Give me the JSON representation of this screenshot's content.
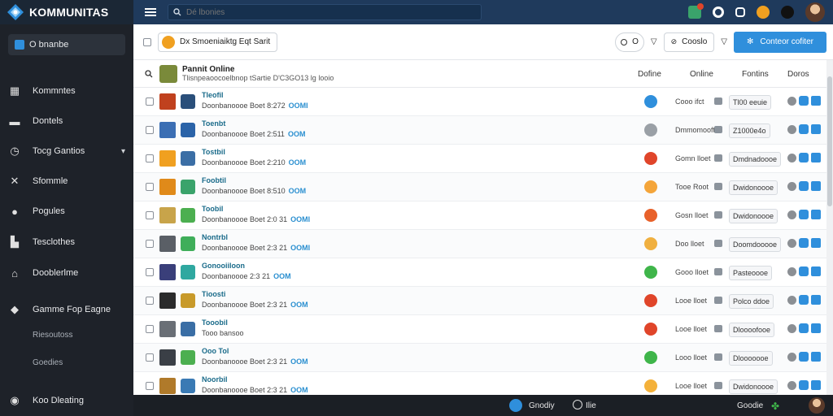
{
  "app": {
    "name": "KOMMUNITAS"
  },
  "search": {
    "placeholder": "Dé lbonies"
  },
  "sidebar": {
    "select_label": "O bnanbe",
    "items": [
      {
        "label": "Kommntes",
        "icon": "calendar-icon"
      },
      {
        "label": "Dontels",
        "icon": "chat-icon"
      },
      {
        "label": "Tocg Gantios",
        "icon": "clock-icon"
      },
      {
        "label": "Sfommle",
        "icon": "cross-icon"
      },
      {
        "label": "Pogules",
        "icon": "comment-icon"
      },
      {
        "label": "Tesclothes",
        "icon": "building-icon"
      },
      {
        "label": "Dooblerlme",
        "icon": "home-icon"
      },
      {
        "label": "Gamme Fop Eagne",
        "icon": "diamond-icon"
      },
      {
        "label": "Koo Dleating",
        "icon": "globe-icon"
      }
    ],
    "sub_items": [
      "Riesoutoss",
      "Goedies"
    ]
  },
  "toolbar": {
    "filter_label": "Dx Smoeniaiktg Eqt Sarit",
    "view_label": "O",
    "sort_label": "Cooslo",
    "primary_label": "Conteor cofiter"
  },
  "list": {
    "title": "Pannit Online",
    "subtitle": "Tlisnpeaoocoelbnop tSartie D'C3GO13 lg looio",
    "columns": [
      "Dofine",
      "Online",
      "Fontins",
      "Doros"
    ]
  },
  "rows": [
    {
      "title": "Tleofil",
      "meta": "Doonbanoooe Boet 8:272",
      "tag": "OOMI",
      "status": "#2f8fdc",
      "online": "Cooo ifct",
      "forum": "Tl00 eeuie",
      "thumb": "#c0411e",
      "thumb2": "#2a4f7a"
    },
    {
      "title": "Toenbt",
      "meta": "Doonbanoooe Boet 2:511",
      "tag": "OOM",
      "status": "#9aa0a6",
      "online": "Dmmomooft",
      "forum": "Z1000e4o",
      "thumb": "#3c6fb4",
      "thumb2": "#2a63a8"
    },
    {
      "title": "Tostbil",
      "meta": "Doonbanoooe Boet 2:210",
      "tag": "OOM",
      "status": "#e0452a",
      "online": "Gomn lloet",
      "forum": "Dmdnadoooe",
      "thumb": "#f0a020",
      "thumb2": "#3b6ea5"
    },
    {
      "title": "Foobtil",
      "meta": "Doonbanoooe Boet 8:510",
      "tag": "OOM",
      "status": "#f4a53a",
      "online": "Tooe Root",
      "forum": "Dwidonoooe",
      "thumb": "#e08a1a",
      "thumb2": "#3aa36b"
    },
    {
      "title": "Toobil",
      "meta": "Doonbanoooe Boet 2:0 31",
      "tag": "OOMI",
      "status": "#e8612a",
      "online": "Gosn lloet",
      "forum": "Dwidonoooe",
      "thumb": "#c8a44a",
      "thumb2": "#4caf50"
    },
    {
      "title": "Nontrbl",
      "meta": "Doonbanoooe Boet 2:3 21",
      "tag": "OOMI",
      "status": "#f0b040",
      "online": "Doo lloet",
      "forum": "Doomdooooe",
      "thumb": "#5a5f66",
      "thumb2": "#3fae5a"
    },
    {
      "title": "Gonooiiloon",
      "meta": "Doonbanoooe 2:3 21",
      "tag": "OOM",
      "status": "#3fb54a",
      "online": "Gooo lloet",
      "forum": "Pasteoooe",
      "thumb": "#3a3f7a",
      "thumb2": "#2fa8a0"
    },
    {
      "title": "Tioosti",
      "meta": "Doonbanoooe Boet 2:3 21",
      "tag": "OOM",
      "status": "#e0452a",
      "online": "Looe lloet",
      "forum": "Polco ddoe",
      "thumb": "#2b2b2b",
      "thumb2": "#c89a2a"
    },
    {
      "title": "Tooobil",
      "meta": "Tooo bansoo",
      "tag": "",
      "status": "#e0452a",
      "online": "Looe lloet",
      "forum": "Dloooofooe",
      "thumb": "#6a6f76",
      "thumb2": "#3a6ea5"
    },
    {
      "title": "Ooo Tol",
      "meta": "Doonbanoooe Boet 2:3 21",
      "tag": "OOM",
      "status": "#3fb54a",
      "online": "Looo lloet",
      "forum": "Dlooooooe",
      "thumb": "#3a3f46",
      "thumb2": "#4caf50"
    },
    {
      "title": "Noorbil",
      "meta": "Doonbanoooe Boet 2:3 21",
      "tag": "OOM",
      "status": "#f4b13a",
      "online": "Looe lloet",
      "forum": "Dwidonoooe",
      "thumb": "#b07a2a",
      "thumb2": "#3a7ab4"
    }
  ],
  "bottom": {
    "left_label": "Gnodiy",
    "left_label2": "Ilie",
    "right_label": "Goodie"
  }
}
